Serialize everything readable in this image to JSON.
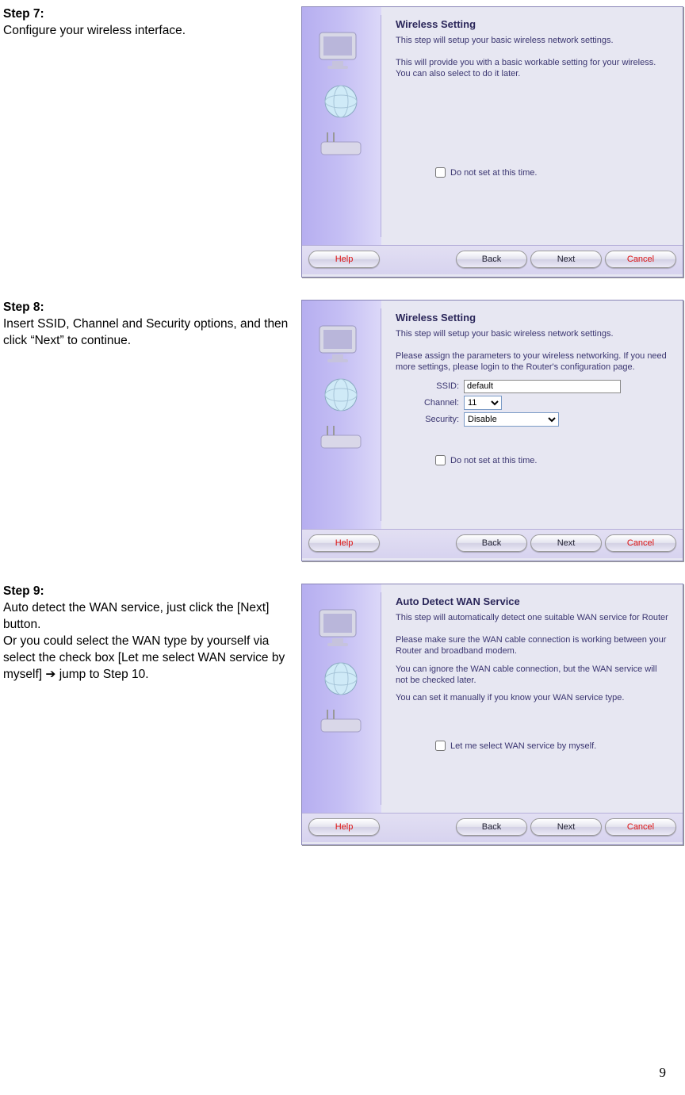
{
  "step7": {
    "heading": "Step 7:",
    "desc": "Configure your wireless interface.",
    "panel": {
      "title": "Wireless Setting",
      "intro": "This step will setup your basic wireless network settings.",
      "note": "This will provide you with a basic workable setting for your wireless. You can also select to do it later.",
      "checkbox_label": "Do not set at this time.",
      "buttons": {
        "help": "Help",
        "back": "Back",
        "next": "Next",
        "cancel": "Cancel"
      }
    }
  },
  "step8": {
    "heading": "Step 8:",
    "desc": "Insert SSID, Channel and Security options, and then click “Next” to continue.",
    "panel": {
      "title": "Wireless Setting",
      "intro": "This step will setup your basic wireless network settings.",
      "note": "Please assign the parameters to your wireless networking. If you need more settings, please login to the Router's configuration page.",
      "ssid_label": "SSID:",
      "ssid_value": "default",
      "channel_label": "Channel:",
      "channel_value": "11",
      "security_label": "Security:",
      "security_value": "Disable",
      "checkbox_label": "Do not set at this time.",
      "buttons": {
        "help": "Help",
        "back": "Back",
        "next": "Next",
        "cancel": "Cancel"
      }
    }
  },
  "step9": {
    "heading": "Step 9:",
    "desc1": "Auto detect the WAN service, just click the [Next] button.",
    "desc2": "Or you could select the WAN type by yourself via select the check box [Let me select WAN service by myself] ➔ jump to Step 10.",
    "panel": {
      "title": "Auto Detect WAN Service",
      "intro": "This step will automatically detect one suitable WAN service for Router",
      "p1": "Please make sure the WAN cable connection is working between your Router and broadband modem.",
      "p2": "You can ignore the WAN cable connection, but the WAN service will not be checked later.",
      "p3": "You can set it manually if you know your WAN service type.",
      "checkbox_label": "Let me select WAN service by myself.",
      "buttons": {
        "help": "Help",
        "back": "Back",
        "next": "Next",
        "cancel": "Cancel"
      }
    }
  },
  "page_number": "9"
}
